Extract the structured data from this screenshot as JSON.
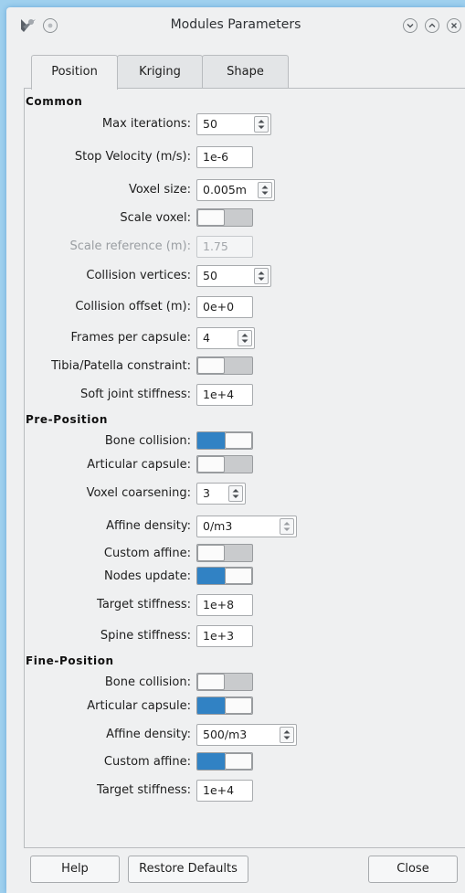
{
  "window": {
    "title": "Modules Parameters",
    "icons": [
      "app-icon",
      "sticky-icon",
      "minimize-icon",
      "maximize-icon",
      "close-icon"
    ]
  },
  "tabs": [
    {
      "label": "Position",
      "active": true
    },
    {
      "label": "Kriging",
      "active": false
    },
    {
      "label": "Shape",
      "active": false
    }
  ],
  "colors": {
    "accent": "#3182c4",
    "toggle_off": "#c9cbcd",
    "background": "#eff0f1"
  },
  "sections": {
    "common": "Common",
    "pre_position": "Pre-Position",
    "fine_position": "Fine-Position"
  },
  "common": {
    "max_iterations": {
      "label": "Max iterations:",
      "value": "50"
    },
    "stop_velocity": {
      "label": "Stop Velocity (m/s):",
      "value": "1e-6"
    },
    "voxel_size": {
      "label": "Voxel size:",
      "value": "0.005m"
    },
    "scale_voxel": {
      "label": "Scale voxel:",
      "checked": false
    },
    "scale_reference": {
      "label": "Scale reference (m):",
      "value": "1.75",
      "disabled": true
    },
    "collision_vertices": {
      "label": "Collision vertices:",
      "value": "50"
    },
    "collision_offset": {
      "label": "Collision offset (m):",
      "value": "0e+0"
    },
    "frames_per_capsule": {
      "label": "Frames per capsule:",
      "value": "4"
    },
    "tibia_patella": {
      "label": "Tibia/Patella constraint:",
      "checked": false
    },
    "soft_joint_stiffness": {
      "label": "Soft joint stiffness:",
      "value": "1e+4"
    }
  },
  "pre_position": {
    "bone_collision": {
      "label": "Bone collision:",
      "checked": true
    },
    "articular_capsule": {
      "label": "Articular capsule:",
      "checked": false
    },
    "voxel_coarsening": {
      "label": "Voxel coarsening:",
      "value": "3"
    },
    "affine_density": {
      "label": "Affine density:",
      "value": "0/m3"
    },
    "custom_affine": {
      "label": "Custom affine:",
      "checked": false
    },
    "nodes_update": {
      "label": "Nodes update:",
      "checked": true
    },
    "target_stiffness": {
      "label": "Target stiffness:",
      "value": "1e+8"
    },
    "spine_stiffness": {
      "label": "Spine stiffness:",
      "value": "1e+3"
    }
  },
  "fine_position": {
    "bone_collision": {
      "label": "Bone collision:",
      "checked": false
    },
    "articular_capsule": {
      "label": "Articular capsule:",
      "checked": true
    },
    "affine_density": {
      "label": "Affine density:",
      "value": "500/m3"
    },
    "custom_affine": {
      "label": "Custom affine:",
      "checked": true
    },
    "target_stiffness": {
      "label": "Target stiffness:",
      "value": "1e+4"
    }
  },
  "buttons": {
    "help": "Help",
    "restore_defaults": "Restore Defaults",
    "close": "Close"
  }
}
